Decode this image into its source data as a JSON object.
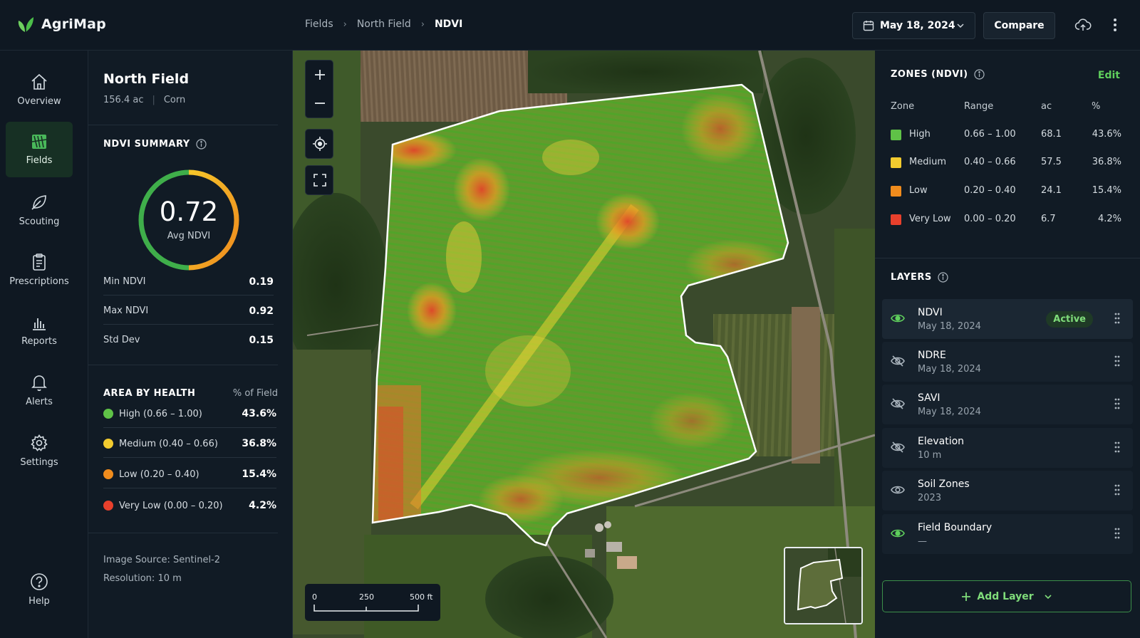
{
  "app": {
    "name": "AgriMap"
  },
  "breadcrumbs": [
    "Fields",
    "North Field",
    "NDVI"
  ],
  "header": {
    "date": "May 18, 2024",
    "compare_label": "Compare"
  },
  "nav": {
    "items": [
      {
        "label": "Overview",
        "icon": "home-icon",
        "active": false
      },
      {
        "label": "Fields",
        "icon": "fields-icon",
        "active": true
      },
      {
        "label": "Scouting",
        "icon": "leaf-icon",
        "active": false
      },
      {
        "label": "Prescriptions",
        "icon": "clipboard-icon",
        "active": false
      },
      {
        "label": "Reports",
        "icon": "bar-chart-icon",
        "active": false
      },
      {
        "label": "Alerts",
        "icon": "bell-icon",
        "active": false
      },
      {
        "label": "Settings",
        "icon": "gear-icon",
        "active": false
      }
    ],
    "help_label": "Help"
  },
  "field": {
    "name": "North Field",
    "area": "156.4 ac",
    "crop": "Corn",
    "ndvi_summary": {
      "title": "NDVI SUMMARY",
      "avg_value": "0.72",
      "avg_label": "Avg NDVI",
      "stats": [
        {
          "label": "Min NDVI",
          "value": "0.19"
        },
        {
          "label": "Max NDVI",
          "value": "0.92"
        },
        {
          "label": "Std Dev",
          "value": "0.15"
        }
      ]
    },
    "area_by_health": {
      "title": "AREA BY HEALTH",
      "column_label": "% of Field",
      "rows": [
        {
          "label": "High (0.66 – 1.00)",
          "value": "43.6%",
          "color": "#5fc247"
        },
        {
          "label": "Medium (0.40 – 0.66)",
          "value": "36.8%",
          "color": "#f2cb2f"
        },
        {
          "label": "Low (0.20 – 0.40)",
          "value": "15.4%",
          "color": "#f08c1d"
        },
        {
          "label": "Very Low (0.00 – 0.20)",
          "value": "4.2%",
          "color": "#e8402c"
        }
      ]
    },
    "image_source": "Image Source: Sentinel-2",
    "resolution": "Resolution: 10 m"
  },
  "map": {
    "scale_labels": [
      "0",
      "250",
      "500 ft"
    ]
  },
  "zones": {
    "title": "ZONES (NDVI)",
    "edit_label": "Edit",
    "columns": [
      "Zone",
      "Range",
      "ac",
      "%"
    ],
    "rows": [
      {
        "zone": "High",
        "range": "0.66 – 1.00",
        "ac": "68.1",
        "pct": "43.6%",
        "color": "#5fc247"
      },
      {
        "zone": "Medium",
        "range": "0.40 – 0.66",
        "ac": "57.5",
        "pct": "36.8%",
        "color": "#f2cb2f"
      },
      {
        "zone": "Low",
        "range": "0.20 – 0.40",
        "ac": "24.1",
        "pct": "15.4%",
        "color": "#f08c1d"
      },
      {
        "zone": "Very Low",
        "range": "0.00 – 0.20",
        "ac": "6.7",
        "pct": "4.2%",
        "color": "#e8402c"
      }
    ]
  },
  "layers": {
    "title": "LAYERS",
    "items": [
      {
        "name": "NDVI",
        "sub": "May 18, 2024",
        "badge": "Active",
        "visible": true
      },
      {
        "name": "NDRE",
        "sub": "May 18, 2024",
        "visible": false
      },
      {
        "name": "SAVI",
        "sub": "May 18, 2024",
        "visible": false
      },
      {
        "name": "Elevation",
        "sub": "10 m",
        "visible": false
      },
      {
        "name": "Soil Zones",
        "sub": "2023",
        "visible": false
      },
      {
        "name": "Field Boundary",
        "sub": "—",
        "visible": true
      }
    ],
    "add_label": "Add Layer"
  },
  "colors": {
    "accent": "#5fcf5c",
    "active_nav": "#173024"
  }
}
